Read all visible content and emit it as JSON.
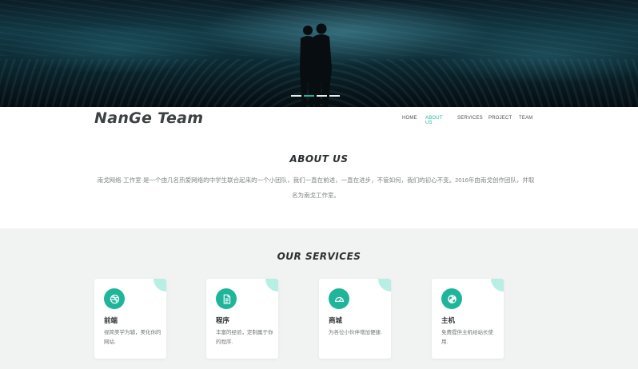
{
  "brand": {
    "name": "NanGe Team"
  },
  "hero": {
    "slide_count": 4,
    "active_slide": 2
  },
  "nav": {
    "items": [
      {
        "label": "HOME",
        "active": false
      },
      {
        "label": "ABOUT US",
        "active": true
      },
      {
        "label": "SERVICES",
        "active": false
      },
      {
        "label": "PROJECT",
        "active": false
      },
      {
        "label": "TEAM",
        "active": false
      }
    ]
  },
  "about": {
    "title": "ABOUT US",
    "text": "南戈网络·工作室·是一个由几名热爱网络的中学生联合起来的一个小团队，我们一直在前进，一直在进步，不管如何，我们的初心不变。2016年由南戈创作团队，并取名为南戈工作室。"
  },
  "services": {
    "title": "OUR SERVICES",
    "cards": [
      {
        "icon": "dribbble-icon",
        "title": "前端",
        "desc": "视简美学为辅，美化你的网站."
      },
      {
        "icon": "document-icon",
        "title": "程序",
        "desc": "丰富的经验，定制属于你的程序."
      },
      {
        "icon": "gauge-icon",
        "title": "商城",
        "desc": "为各位小伙伴增加便捷."
      },
      {
        "icon": "globe-icon",
        "title": "主机",
        "desc": "免费提供主机给站长使用."
      }
    ]
  },
  "colors": {
    "accent": "#1fb59a",
    "accent_light": "#b8eee3",
    "text_dark": "#2e3335"
  }
}
